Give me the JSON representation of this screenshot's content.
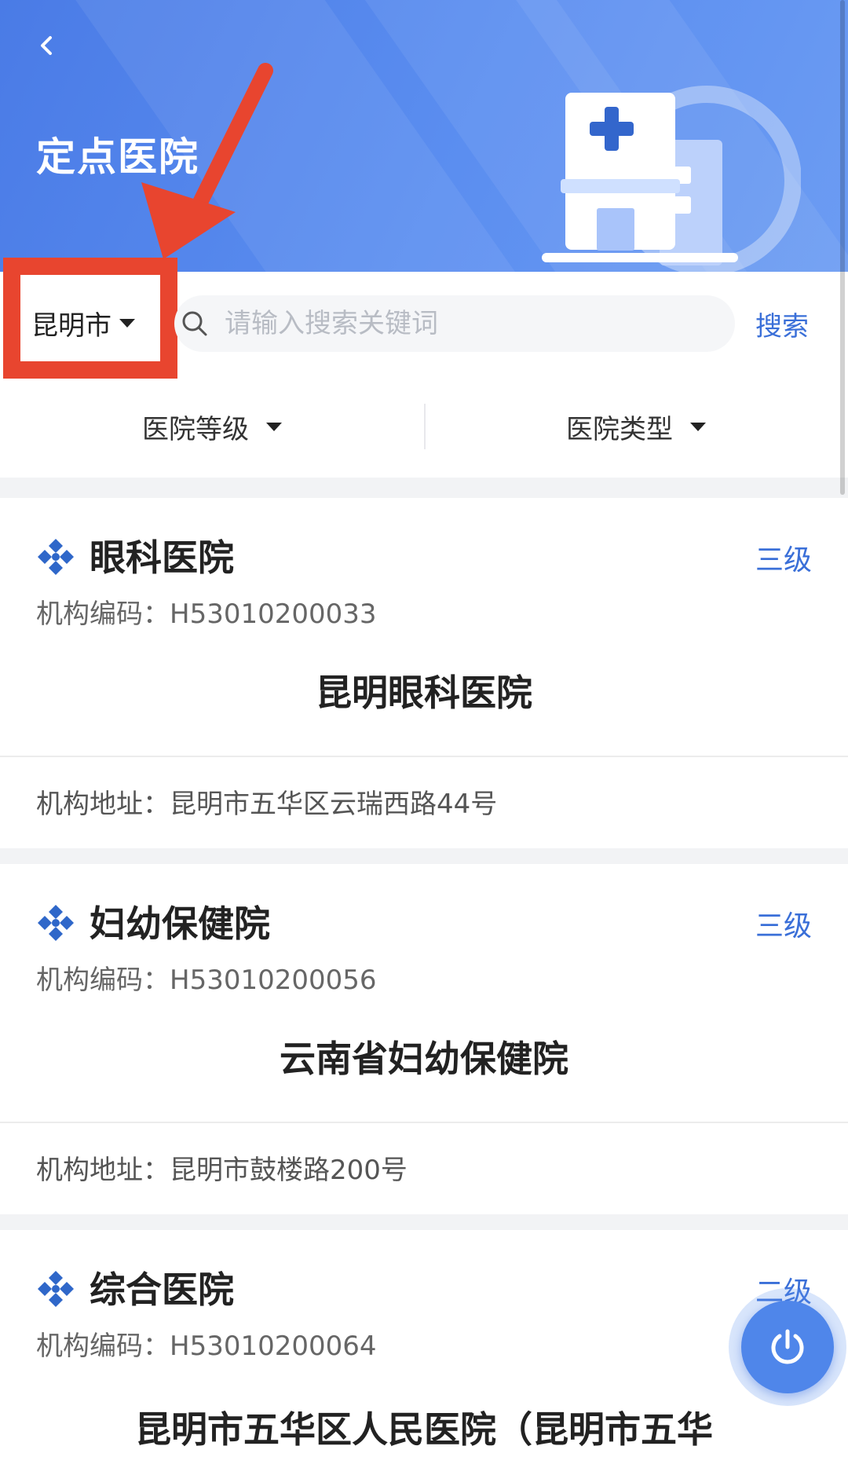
{
  "header": {
    "title": "定点医院",
    "back_icon": "back-arrow-icon",
    "hero_icon": "hospital-building-icon"
  },
  "filters": {
    "city": "昆明市",
    "search_placeholder": "请输入搜索关键词",
    "search_label": "搜索",
    "hospital_level_label": "医院等级",
    "hospital_type_label": "医院类型"
  },
  "labels": {
    "code_prefix": "机构编码：",
    "address_prefix": "机构地址："
  },
  "hospitals": [
    {
      "category": "眼科医院",
      "level": "三级",
      "code": "H53010200033",
      "name": "昆明眼科医院",
      "address": "昆明市五华区云瑞西路44号"
    },
    {
      "category": "妇幼保健院",
      "level": "三级",
      "code": "H53010200056",
      "name": "云南省妇幼保健院",
      "address": "昆明市鼓楼路200号"
    },
    {
      "category": "综合医院",
      "level": "二级",
      "code": "H53010200064",
      "name": "昆明市五华区人民医院（昆明市五华"
    }
  ],
  "colors": {
    "header_blue": "#5b8ef0",
    "accent_blue": "#3a6fd8",
    "annotation_red": "#e8452f"
  },
  "fab_icon": "power-icon"
}
